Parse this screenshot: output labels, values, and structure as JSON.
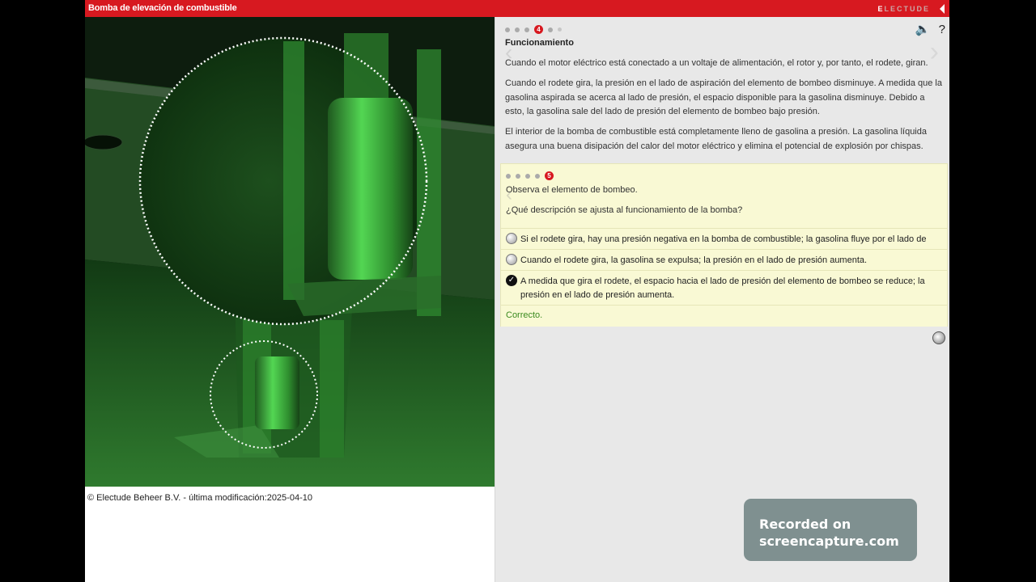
{
  "header": {
    "title": "Bomba de elevación de combustible",
    "brand": "ELECTUDE"
  },
  "media": {
    "caption": "© Electude Beheer B.V. - última modificación:2025-04-10"
  },
  "toolbar": {
    "sound_icon": "speaker-icon",
    "help_label": "?"
  },
  "section": {
    "page_indicator": {
      "current": "4",
      "total_pages": 6
    },
    "title": "Funcionamiento",
    "paragraphs": [
      "Cuando el motor eléctrico está conectado a un voltaje de alimentación, el rotor y, por tanto, el rodete, giran.",
      "Cuando el rodete gira, la presión en el lado de aspiración del elemento de bombeo disminuye. A medida que la gasolina aspirada se acerca al lado de presión, el espacio disponible para la gasolina disminuye. Debido a esto, la gasolina sale del lado de presión del elemento de bombeo bajo presión.",
      "El interior de la bomba de combustible está completamente lleno de gasolina a presión. La gasolina líquida asegura una buena disipación del calor del motor eléctrico y elimina el potencial de explosión por chispas."
    ]
  },
  "quiz": {
    "page_indicator": {
      "current": "5",
      "total_pages": 5
    },
    "instruction": "Observa el elemento de bombeo.",
    "question": "¿Qué descripción se ajusta al funcionamiento de la bomba?",
    "options": [
      {
        "label": "Si el rodete gira, hay una presión negativa en la bomba de combustible; la gasolina fluye por el lado de presión.",
        "selected": false
      },
      {
        "label": "Cuando el rodete gira, la gasolina se expulsa; la presión en el lado de presión aumenta.",
        "selected": false
      },
      {
        "label": "A medida que gira el rodete, el espacio hacia el lado de presión del elemento de bombeo se reduce; la presión en el lado de presión aumenta.",
        "selected": true
      }
    ],
    "feedback": "Correcto."
  },
  "overlay": {
    "line1": "Recorded on",
    "line2": "screencapture.com"
  },
  "colors": {
    "brand_red": "#d71920",
    "correct_green": "#3a8a1f",
    "quiz_bg": "#f9f9d4"
  }
}
